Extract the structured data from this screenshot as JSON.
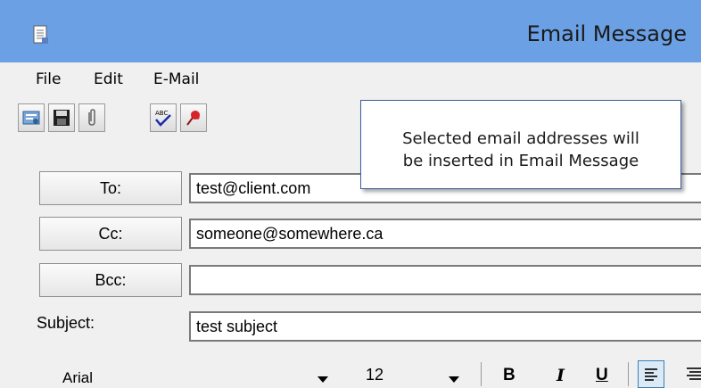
{
  "window": {
    "title": "Email Message"
  },
  "menu": {
    "items": [
      "File",
      "Edit",
      "E-Mail"
    ]
  },
  "toolbar": {
    "buttons": [
      "address-book",
      "save",
      "attach",
      "spell-check",
      "pin"
    ]
  },
  "fields": {
    "to": {
      "label": "To:",
      "value": "test@client.com"
    },
    "cc": {
      "label": "Cc:",
      "value": "someone@somewhere.ca"
    },
    "bcc": {
      "label": "Bcc:",
      "value": ""
    },
    "subject": {
      "label": "Subject:",
      "value": "test subject"
    }
  },
  "tooltip": {
    "line1": "Selected email addresses will",
    "line2": "be inserted in Email Message"
  },
  "format": {
    "font": "Arial",
    "size": "12",
    "bold": "B",
    "italic": "I",
    "underline": "U"
  },
  "colors": {
    "titlebar": "#6ba0e4",
    "window": "#f0f0f0",
    "tooltip_border": "#3b5f9c"
  }
}
